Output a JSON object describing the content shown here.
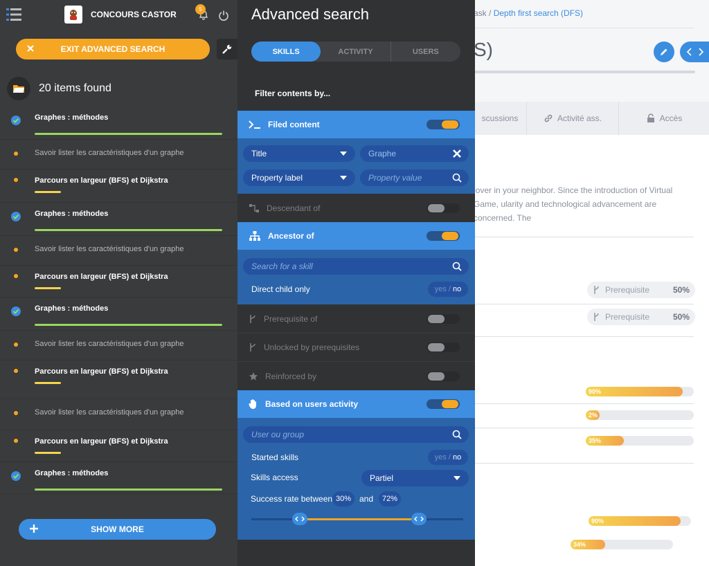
{
  "page": {
    "breadcrumb_prefix": "ask / ",
    "breadcrumb_link": "Depth first search (DFS)",
    "title_fragment": "S)",
    "tabs": [
      "scussions",
      "Activité ass.",
      "Accès"
    ],
    "text": "lover in your neighbor. Since the introduction of Virtual Game, ularity and technological advancement are concerned. The",
    "text_end": ".",
    "prereqs": [
      {
        "label": "Prerequisite",
        "pct": "50%"
      },
      {
        "label": "Prerequisite",
        "pct": "50%"
      }
    ],
    "progress": [
      {
        "label": "90%",
        "value": 0.9
      },
      {
        "label": "2%",
        "value": 0.02
      },
      {
        "label": "35%",
        "value": 0.35
      },
      {
        "label": "90%",
        "value": 0.9
      },
      {
        "label": "34%",
        "value": 0.34
      }
    ]
  },
  "left": {
    "app_name": "CONCOURS CASTOR",
    "notif_count": "5",
    "exit_label": "EXIT ADVANCED SEARCH",
    "found_label": "20 items found",
    "items": [
      {
        "label": "Graphes : méthodes",
        "style": "check",
        "bar": "green"
      },
      {
        "label": "Savoir lister les caractéristiques d'un graphe",
        "style": "dot",
        "bar": "none"
      },
      {
        "label": "Parcours en largeur (BFS) et Dijkstra",
        "style": "dot-bold",
        "bar": "yellow"
      },
      {
        "label": "Graphes : méthodes",
        "style": "check",
        "bar": "green"
      },
      {
        "label": "Savoir lister les caractéristiques d'un graphe",
        "style": "dot",
        "bar": "none"
      },
      {
        "label": "Parcours en largeur (BFS) et Dijkstra",
        "style": "dot-bold",
        "bar": "yellow"
      },
      {
        "label": "Graphes : méthodes",
        "style": "check",
        "bar": "green"
      },
      {
        "label": "Savoir lister les caractéristiques d'un graphe",
        "style": "dot",
        "bar": "none"
      },
      {
        "label": "Parcours en largeur (BFS) et Dijkstra",
        "style": "dot-bold",
        "bar": "yellow"
      },
      {
        "label": "Savoir lister les caractéristiques d'un graphe",
        "style": "dot",
        "bar": "none"
      },
      {
        "label": "Parcours en largeur (BFS) et Dijkstra",
        "style": "dot-bold",
        "bar": "yellow"
      },
      {
        "label": "Graphes : méthodes",
        "style": "check",
        "bar": "green"
      }
    ],
    "show_more": "SHOW MORE"
  },
  "adv": {
    "title": "Advanced search",
    "tabs": {
      "skills": "SKILLS",
      "activity": "ACTIVITY",
      "users": "USERS"
    },
    "filter_by": "Filter contents by...",
    "filed_content": {
      "title": "Filed content",
      "field1": "Title",
      "value1": "Graphe",
      "field2": "Property label",
      "value2_placeholder": "Property value"
    },
    "descendant": "Descendant of",
    "ancestor": {
      "title": "Ancestor of",
      "search_placeholder": "Search for a skill",
      "direct_child": "Direct child only",
      "yes": "yes",
      "no": "no"
    },
    "prerequisite": "Prerequisite of",
    "unlocked": "Unlocked by prerequisites",
    "reinforced": "Reinforced by",
    "users_activity": {
      "title": "Based on users activity",
      "group_placeholder": "User ou group",
      "started": "Started skills",
      "yes": "yes",
      "no": "no",
      "access_label": "Skills access",
      "access_value": "Partiel",
      "success_label": "Success rate between",
      "min": "30%",
      "and": "and",
      "max": "72%"
    }
  },
  "colors": {
    "accent": "#3b8de0",
    "orange": "#f5a623",
    "green": "#9ad75d",
    "yellow": "#f6d44e"
  }
}
